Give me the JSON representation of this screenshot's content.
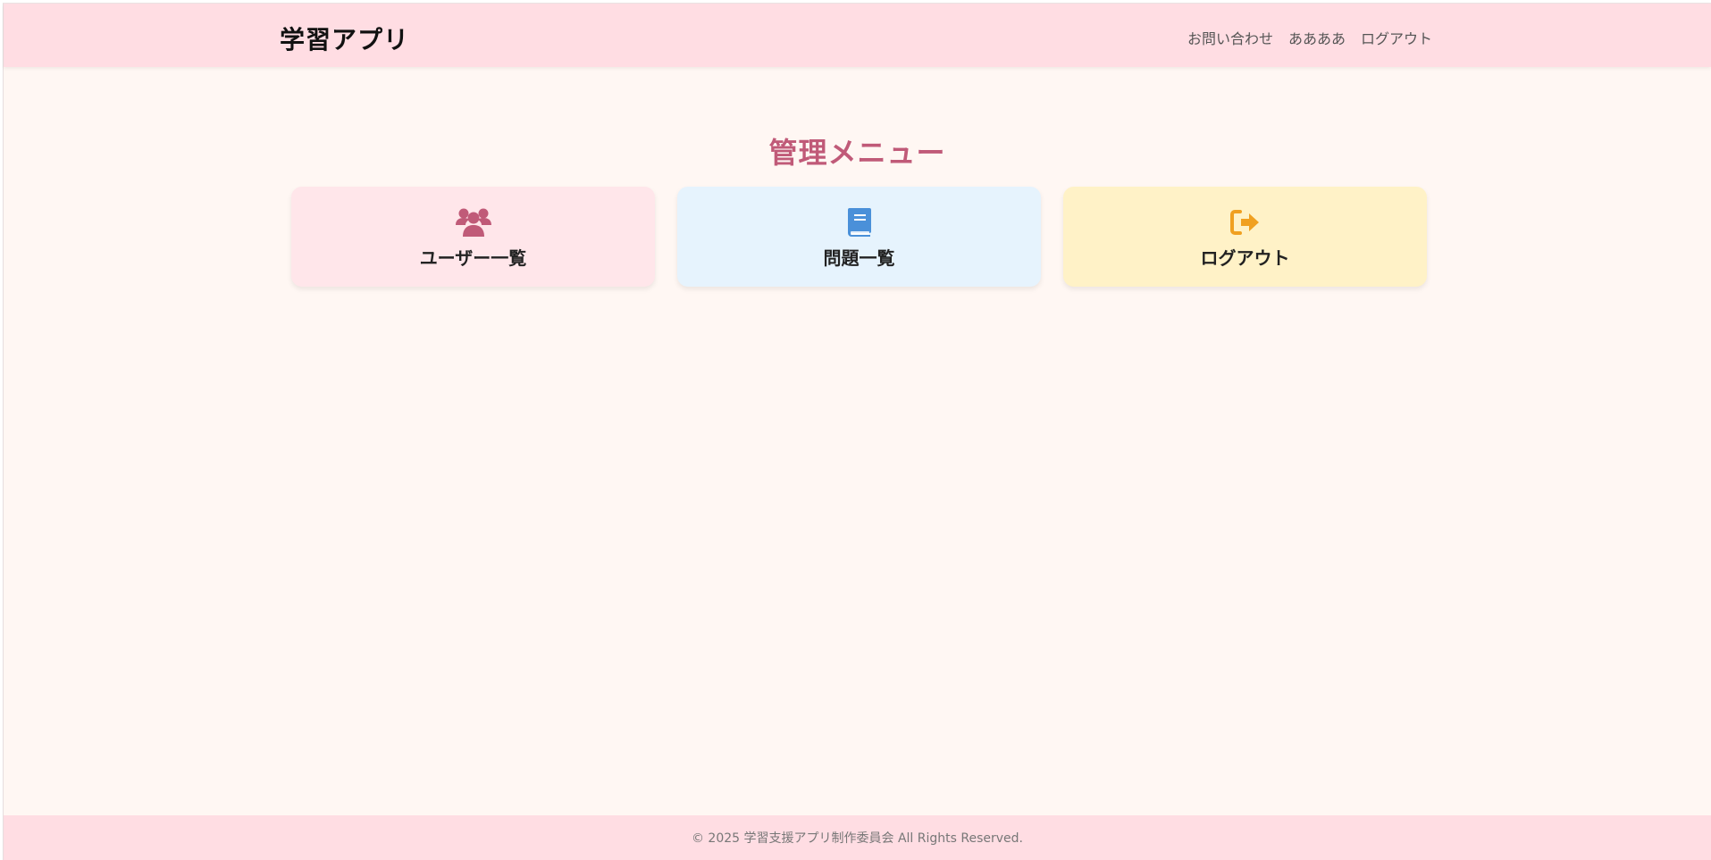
{
  "header": {
    "brand": "学習アプリ",
    "nav": [
      {
        "label": "お問い合わせ"
      },
      {
        "label": "ああああ"
      },
      {
        "label": "ログアウト"
      }
    ]
  },
  "main": {
    "title": "管理メニュー",
    "cards": [
      {
        "label": "ユーザー一覧",
        "icon": "users-icon",
        "color": "#c05a78",
        "background": "#ffe6ea"
      },
      {
        "label": "問題一覧",
        "icon": "book-icon",
        "color": "#4a90d9",
        "background": "#e6f3fd"
      },
      {
        "label": "ログアウト",
        "icon": "sign-out-icon",
        "color": "#f0a020",
        "background": "#fff2c7"
      }
    ]
  },
  "footer": {
    "copyright": "© 2025 学習支援アプリ制作委員会 All Rights Reserved."
  },
  "colors": {
    "header_bg": "#ffdde3",
    "page_bg": "#fff7f3",
    "title": "#c05a78"
  }
}
